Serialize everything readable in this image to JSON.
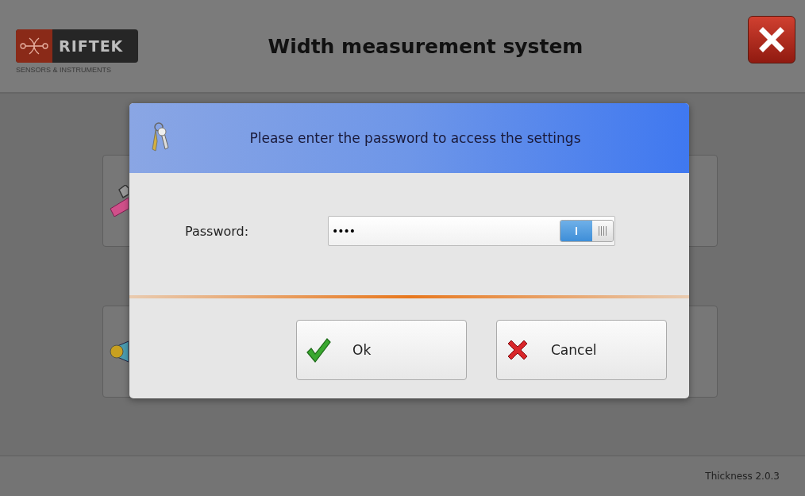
{
  "header": {
    "logo_name": "RIFTEK",
    "logo_tagline": "SENSORS & INSTRUMENTS",
    "title": "Width measurement system"
  },
  "tiles": [
    {
      "kind": "tool"
    },
    {
      "kind": "disc"
    }
  ],
  "dialog": {
    "title": "Please enter the password to access the settings",
    "field_label": "Password:",
    "password": "••••",
    "reveal_toggle": {
      "on": true
    },
    "buttons": [
      {
        "label": "Ok",
        "kind": "ok"
      },
      {
        "label": "Cancel",
        "kind": "cancel"
      }
    ]
  },
  "status_bar": {
    "version": "Thickness 2.0.3"
  }
}
